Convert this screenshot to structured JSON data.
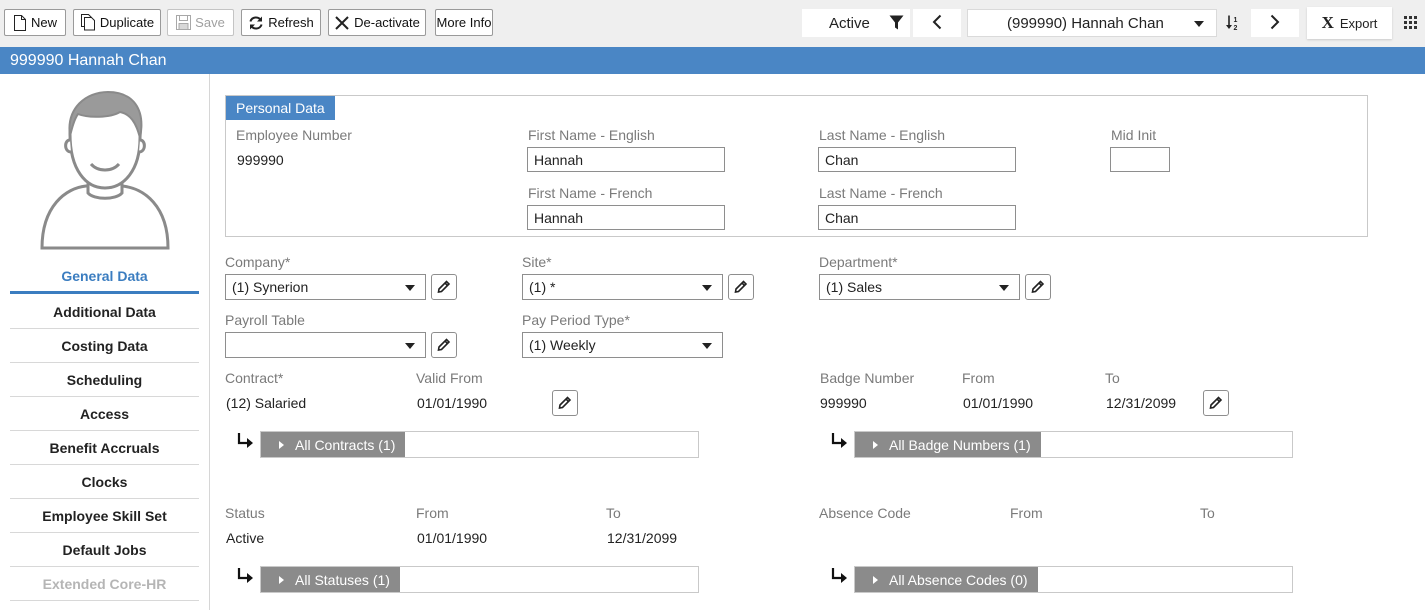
{
  "toolbar": {
    "new_label": "New",
    "duplicate_label": "Duplicate",
    "save_label": "Save",
    "refresh_label": "Refresh",
    "deactivate_label": "De-activate",
    "more_info_label": "More Info",
    "filter_status": "Active",
    "employee_select": "(999990) Hannah Chan",
    "export_label": "Export"
  },
  "title": "999990 Hannah Chan",
  "sidebar": {
    "items": [
      {
        "label": "General Data"
      },
      {
        "label": "Additional Data"
      },
      {
        "label": "Costing Data"
      },
      {
        "label": "Scheduling"
      },
      {
        "label": "Access"
      },
      {
        "label": "Benefit Accruals"
      },
      {
        "label": "Clocks"
      },
      {
        "label": "Employee Skill Set"
      },
      {
        "label": "Default Jobs"
      },
      {
        "label": "Extended Core-HR"
      }
    ]
  },
  "personal": {
    "section_title": "Personal Data",
    "employee_number_label": "Employee Number",
    "employee_number": "999990",
    "first_name_en_label": "First Name - English",
    "first_name_en": "Hannah",
    "last_name_en_label": "Last Name - English",
    "last_name_en": "Chan",
    "mid_init_label": "Mid Init",
    "mid_init": "",
    "first_name_fr_label": "First Name - French",
    "first_name_fr": "Hannah",
    "last_name_fr_label": "Last Name - French",
    "last_name_fr": "Chan"
  },
  "org": {
    "company_label": "Company*",
    "company": "(1) Synerion",
    "site_label": "Site*",
    "site": "(1) *",
    "department_label": "Department*",
    "department": "(1) Sales",
    "payroll_table_label": "Payroll Table",
    "payroll_table": "",
    "pay_period_label": "Pay Period Type*",
    "pay_period": "(1) Weekly"
  },
  "contract": {
    "label": "Contract*",
    "valid_from_label": "Valid From",
    "value": "(12) Salaried",
    "valid_from": "01/01/1990",
    "all_label": "All Contracts (1)"
  },
  "badge": {
    "label": "Badge Number",
    "from_label": "From",
    "to_label": "To",
    "value": "999990",
    "from": "01/01/1990",
    "to": "12/31/2099",
    "all_label": "All Badge Numbers (1)"
  },
  "status": {
    "label": "Status",
    "from_label": "From",
    "to_label": "To",
    "value": "Active",
    "from": "01/01/1990",
    "to": "12/31/2099",
    "all_label": "All Statuses (1)"
  },
  "absence": {
    "label": "Absence Code",
    "from_label": "From",
    "to_label": "To",
    "all_label": "All Absence Codes (0)"
  }
}
